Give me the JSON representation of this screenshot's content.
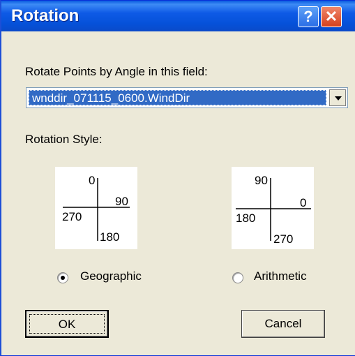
{
  "window": {
    "title": "Rotation",
    "help_label": "?",
    "close_label": "✕"
  },
  "field": {
    "label": "Rotate Points by Angle in this field:",
    "selected_value": "wnddir_071115_0600.WindDir"
  },
  "style": {
    "label": "Rotation Style:",
    "geographic": {
      "label": "Geographic",
      "selected": true,
      "top": "0",
      "right": "90",
      "left": "270",
      "bottom": "180"
    },
    "arithmetic": {
      "label": "Arithmetic",
      "selected": false,
      "top": "90",
      "right": "0",
      "left": "180",
      "bottom": "270"
    }
  },
  "buttons": {
    "ok": "OK",
    "cancel": "Cancel"
  },
  "colors": {
    "titlebar": "#0551d9",
    "face": "#ece9d8",
    "selection": "#316ac5"
  }
}
